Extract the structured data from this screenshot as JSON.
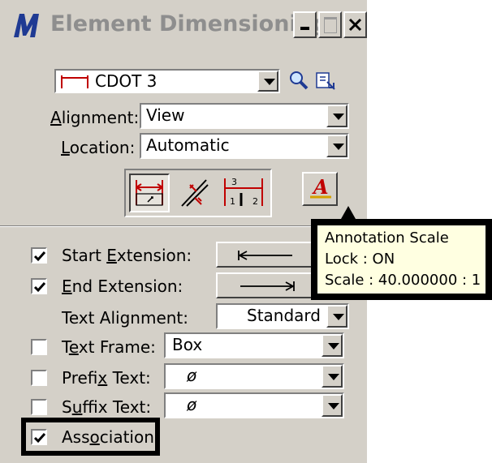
{
  "window": {
    "title": "Element Dimensioning",
    "icon": "microstation-m-icon"
  },
  "style_combo": {
    "value": "CDOT 3"
  },
  "alignment": {
    "label_pre": "",
    "label_key": "A",
    "label_post": "lignment:",
    "value": "View"
  },
  "location": {
    "label_pre": "",
    "label_key": "L",
    "label_post": "ocation:",
    "value": "Automatic"
  },
  "tooltip": {
    "line1": "Annotation Scale",
    "line2": "Lock  : ON",
    "line3": "Scale : 40.000000 : 1"
  },
  "options": {
    "start_extension": {
      "pre": "Start ",
      "key": "E",
      "post": "xtension:",
      "checked": true,
      "button": "|←——"
    },
    "end_extension": {
      "pre": "",
      "key": "E",
      "post": "nd Extension:",
      "checked": true,
      "button": "——→|"
    },
    "text_alignment": {
      "label": "Text Alignment:",
      "value": "Standard"
    },
    "text_frame": {
      "pre": "T",
      "key": "e",
      "post": "xt Frame:",
      "checked": false,
      "value": "Box"
    },
    "prefix_text": {
      "pre": "Prefi",
      "key": "x",
      "post": " Text:",
      "checked": false,
      "value": "ø"
    },
    "suffix_text": {
      "pre": "S",
      "key": "u",
      "post": "ffix Text:",
      "checked": false,
      "value": "ø"
    },
    "association": {
      "pre": "Ass",
      "key": "o",
      "post": "ciation",
      "checked": true
    }
  },
  "colors": {
    "dialog_bg": "#d4d0c8",
    "tooltip_bg": "#ffffe1",
    "accent_red": "#c00000",
    "icon_blue": "#1f3a93"
  }
}
